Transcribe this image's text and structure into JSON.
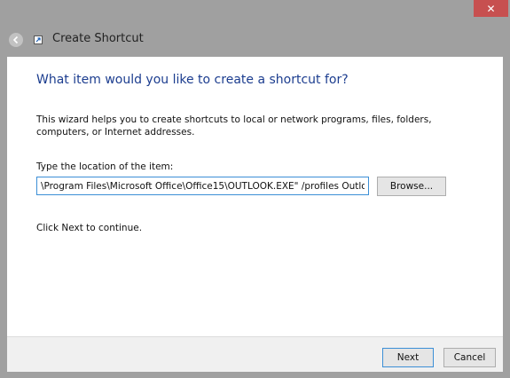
{
  "window": {
    "close_glyph": "✕"
  },
  "wizard": {
    "title": "Create Shortcut"
  },
  "content": {
    "heading": "What item would you like to create a shortcut for?",
    "description": "This wizard helps you to create shortcuts to local or network programs, files, folders, computers, or Internet addresses.",
    "location_label": "Type the location of the item:",
    "location_value": "\\Program Files\\Microsoft Office\\Office15\\OUTLOOK.EXE\" /profiles Outlook",
    "browse_label": "Browse...",
    "continue_text": "Click Next to continue."
  },
  "footer": {
    "next_label": "Next",
    "cancel_label": "Cancel"
  },
  "colors": {
    "accent": "#3c8fd6",
    "heading": "#1c3d8f",
    "close": "#c75050"
  }
}
